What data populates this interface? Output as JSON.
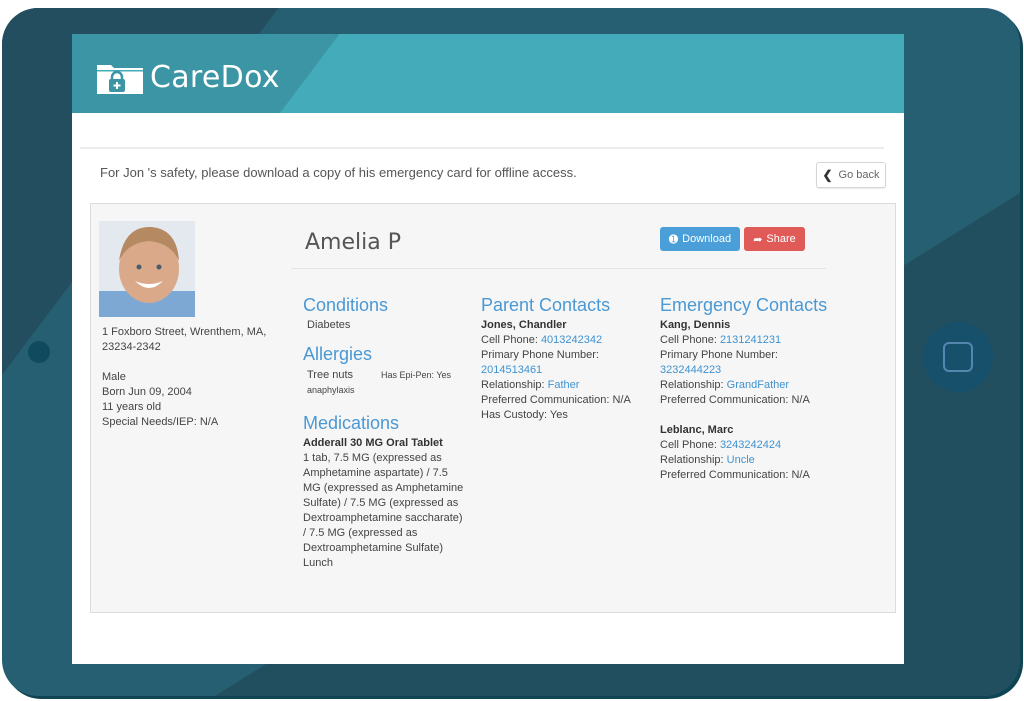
{
  "app": {
    "brand": "CareDox",
    "colors": {
      "header": "#43abb9",
      "accent": "#4a98d4",
      "download": "#4a9fd8",
      "share": "#e05a57",
      "frame": "#275f72"
    }
  },
  "notice": {
    "message": "For Jon 's safety, please download a copy of his emergency card for offline access.",
    "go_back_label": "Go back"
  },
  "student": {
    "name": "Amelia P",
    "address_line1": "1 Foxboro Street, Wrenthem, MA,",
    "address_line2": "23234-2342",
    "gender": "Male",
    "born": "Born Jun 09, 2004",
    "age": "11 years old",
    "special_needs": "Special Needs/IEP: N/A"
  },
  "actions": {
    "download_label": "Download",
    "share_label": "Share"
  },
  "conditions": {
    "title": "Conditions",
    "items": [
      "Diabetes"
    ]
  },
  "allergies": {
    "title": "Allergies",
    "items": [
      {
        "name": "Tree nuts",
        "epi_pen": "Has Epi-Pen: Yes",
        "reaction": "anaphylaxis"
      }
    ]
  },
  "medications": {
    "title": "Medications",
    "items": [
      {
        "name": "Adderall 30 MG Oral Tablet",
        "detail_lines": [
          "1 tab, 7.5 MG (expressed as",
          "Amphetamine aspartate) / 7.5",
          "MG (expressed as Amphetamine",
          "Sulfate) / 7.5 MG (expressed as",
          "Dextroamphetamine saccharate)",
          "/ 7.5 MG (expressed as",
          "Dextroamphetamine Sulfate)",
          "Lunch"
        ]
      }
    ]
  },
  "parent_contacts": {
    "title": "Parent Contacts",
    "items": [
      {
        "name": "Jones, Chandler",
        "cell_label": "Cell Phone: ",
        "cell": "4013242342",
        "primary_label": "Primary Phone Number:",
        "primary": "2014513461",
        "relationship_label": "Relationship: ",
        "relationship": "Father",
        "preferred": "Preferred Communication: N/A",
        "custody": "Has Custody: Yes"
      }
    ]
  },
  "emergency_contacts": {
    "title": "Emergency Contacts",
    "items": [
      {
        "name": "Kang, Dennis",
        "cell_label": "Cell Phone: ",
        "cell": "2131241231",
        "primary_label": "Primary Phone Number:",
        "primary": "3232444223",
        "relationship_label": "Relationship: ",
        "relationship": "GrandFather",
        "preferred": "Preferred Communication: N/A"
      },
      {
        "name": "Leblanc, Marc",
        "cell_label": "Cell Phone: ",
        "cell": "3243242424",
        "relationship_label": "Relationship: ",
        "relationship": "Uncle",
        "preferred": "Preferred Communication: N/A"
      }
    ]
  }
}
